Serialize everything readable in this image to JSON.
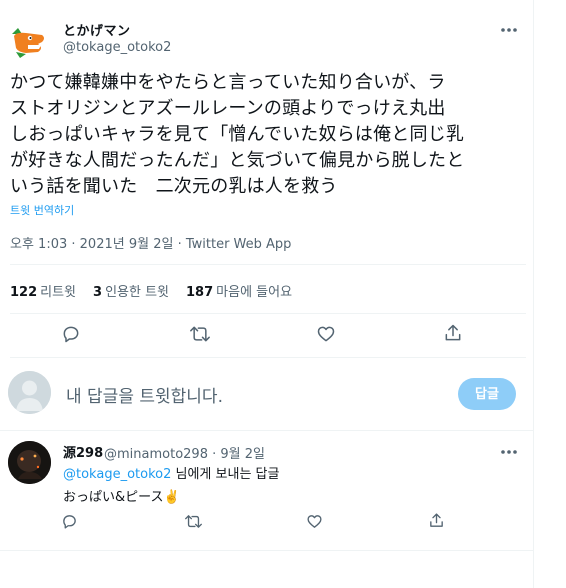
{
  "tweet": {
    "author_name": "とかげマン",
    "author_handle": "@tokage_otoko2",
    "text_lines": [
      "かつて嫌韓嫌中をやたらと言っていた知り合いが、ラ",
      "ストオリジンとアズールレーンの頭よりでっけえ丸出",
      "しおっぱいキャラを見て「憎んでいた奴らは俺と同じ乳",
      "が好きな人間だったんだ」と気づいて偏見から脱したと",
      "いう話を聞いた　二次元の乳は人を救う"
    ],
    "translate_label": "트윗 번역하기",
    "time": "오후 1:03",
    "date": "2021년 9월 2일",
    "source": "Twitter Web App",
    "stats": {
      "retweets_count": "122",
      "retweets_label": "리트윗",
      "quotes_count": "3",
      "quotes_label": "인용한 트윗",
      "likes_count": "187",
      "likes_label": "마음에 들어요"
    }
  },
  "composer": {
    "placeholder": "내 답글을 트윗합니다.",
    "button_label": "답글"
  },
  "reply": {
    "name": "源298",
    "handle": "@minamoto298",
    "date": "9월 2일",
    "reply_to_handle": "@tokage_otoko2",
    "reply_to_suffix": "님에게 보내는 답글",
    "text": "おっぱい&ピース✌️"
  },
  "colors": {
    "accent": "#1d9bf0",
    "secondary_text": "#536471",
    "divider": "#eff3f4",
    "reply_button_disabled": "#8ecdf8"
  },
  "icons": {
    "more": "more-horizontal-icon",
    "reply": "comment-icon",
    "retweet": "retweet-icon",
    "like": "heart-icon",
    "share": "share-icon"
  }
}
